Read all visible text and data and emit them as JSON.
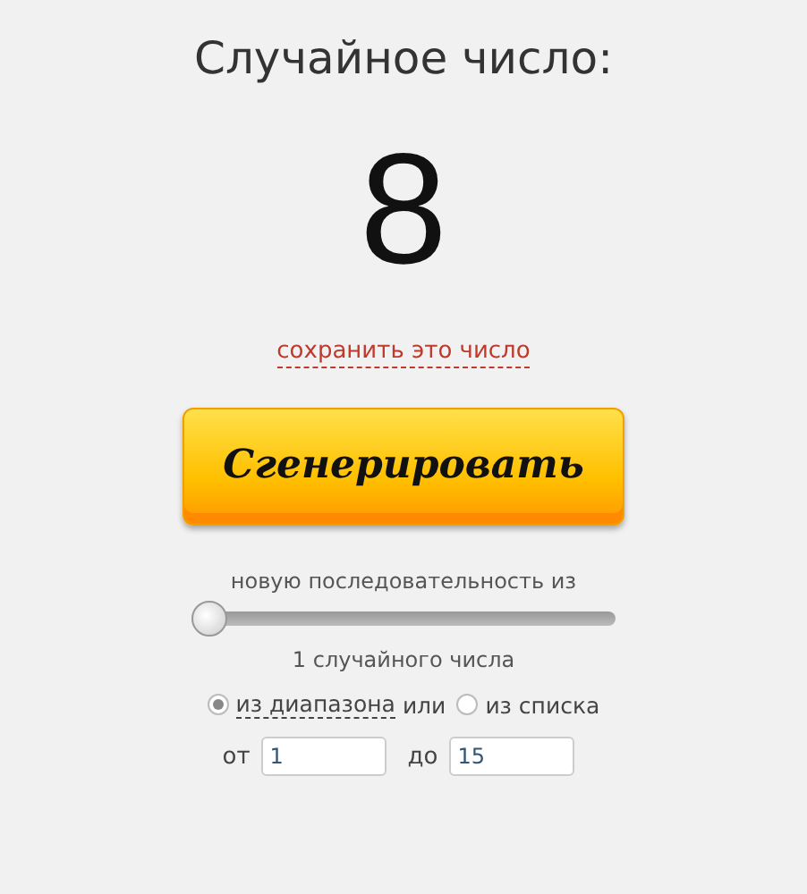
{
  "title": "Случайное число:",
  "result": "8",
  "save_link": "сохранить это число",
  "generate_button": "Сгенерировать",
  "sequence_label": "новую последовательность из",
  "count_slider": {
    "level": 0
  },
  "count_text": "1 случайного числа",
  "sources": [
    {
      "label": "из диапазона",
      "selected": true
    },
    {
      "label": "из списка",
      "selected": false
    }
  ],
  "sources_joiner": "или",
  "range": {
    "from_label": "от",
    "from_value": "1",
    "to_label": "до",
    "to_value": "15"
  }
}
